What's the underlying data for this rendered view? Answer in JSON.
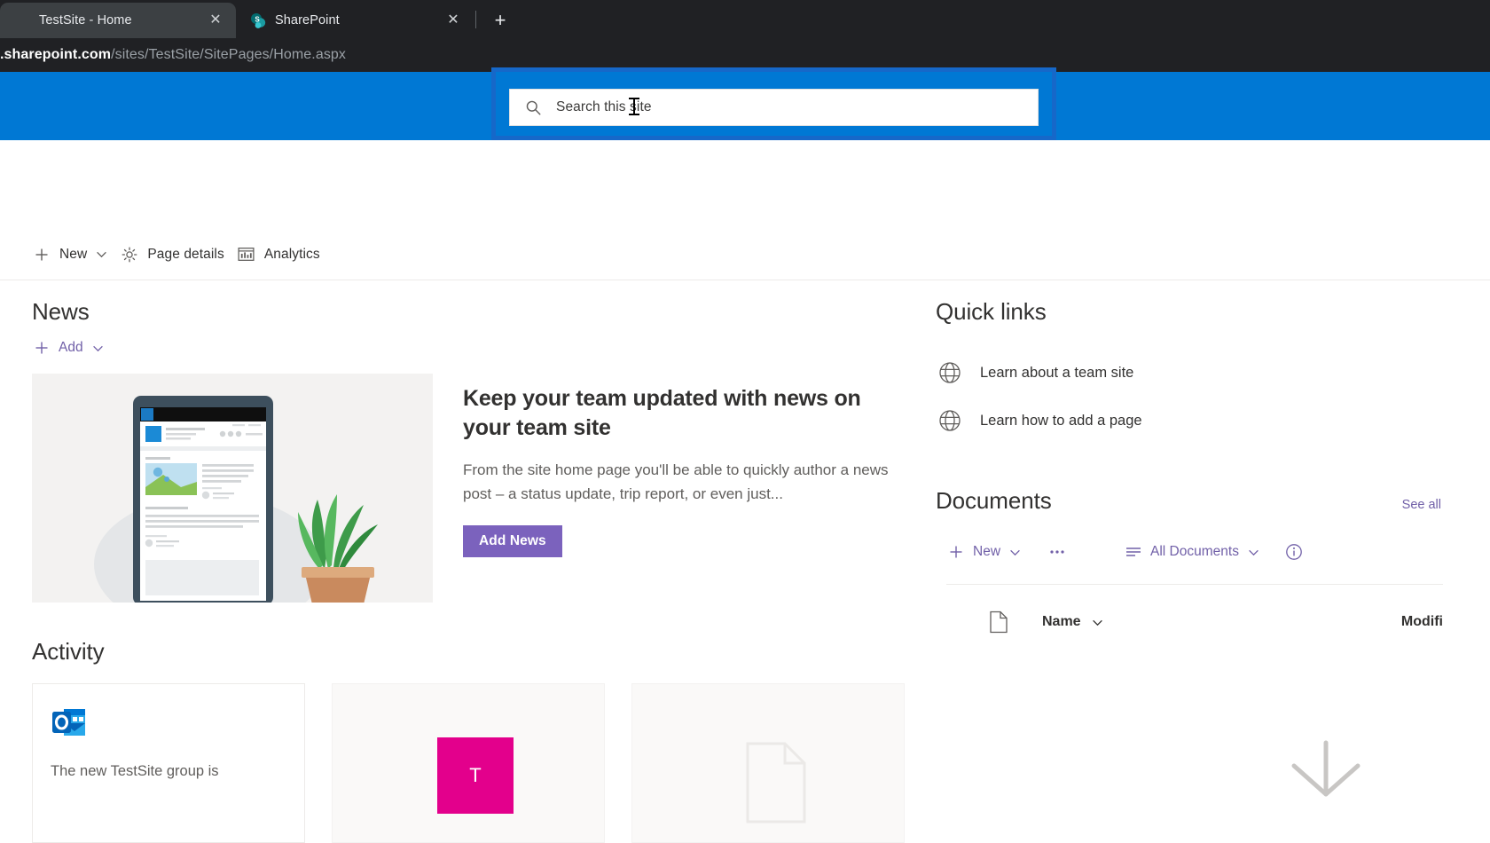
{
  "browser": {
    "tabs": [
      {
        "title": "TestSite - Home",
        "favicon": "none",
        "active": true,
        "close_label": "✕"
      },
      {
        "title": "SharePoint",
        "favicon": "sharepoint-icon",
        "active": false,
        "close_label": "✕"
      }
    ],
    "new_tab_label": "+",
    "url_host": ".sharepoint.com",
    "url_path": "/sites/TestSite/SitePages/Home.aspx"
  },
  "suitebar": {
    "accent_color": "#0078d4",
    "focus_ring_color": "#1668c9"
  },
  "search": {
    "placeholder": "Search this site",
    "value": "",
    "icon": "search-icon"
  },
  "commandbar": {
    "items": [
      {
        "label": "New",
        "icon": "plus-icon",
        "has_chevron": true
      },
      {
        "label": "Page details",
        "icon": "gear-icon",
        "has_chevron": false
      },
      {
        "label": "Analytics",
        "icon": "analytics-icon",
        "has_chevron": false
      }
    ]
  },
  "news": {
    "title": "News",
    "add_label": "Add",
    "card": {
      "heading": "Keep your team updated with news on your team site",
      "description": "From the site home page you'll be able to quickly author a news post – a status update, trip report, or even just...",
      "button_label": "Add News",
      "button_color": "#7b62bd"
    }
  },
  "activity": {
    "title": "Activity",
    "cards": [
      {
        "icon": "outlook-icon",
        "text": "The new TestSite group is"
      },
      {
        "tile_letter": "T",
        "tile_color": "#e3008c",
        "text": ""
      },
      {
        "icon": "file-icon",
        "text": ""
      }
    ]
  },
  "quick_links": {
    "title": "Quick links",
    "items": [
      {
        "label": "Learn about a team site",
        "icon": "globe-icon"
      },
      {
        "label": "Learn how to add a page",
        "icon": "globe-icon"
      }
    ]
  },
  "documents": {
    "title": "Documents",
    "see_all_label": "See all",
    "toolbar": [
      {
        "label": "New",
        "icon": "plus-icon",
        "has_chevron": true
      },
      {
        "label": "",
        "icon": "ellipsis-icon",
        "has_chevron": false
      },
      {
        "label": "All Documents",
        "icon": "list-view-icon",
        "has_chevron": true
      },
      {
        "label": "",
        "icon": "info-icon",
        "has_chevron": false
      }
    ],
    "columns": [
      {
        "label": "",
        "icon": "file-type-icon"
      },
      {
        "label": "Name",
        "has_chevron": true
      },
      {
        "label": "Modifi"
      }
    ],
    "rows": []
  }
}
